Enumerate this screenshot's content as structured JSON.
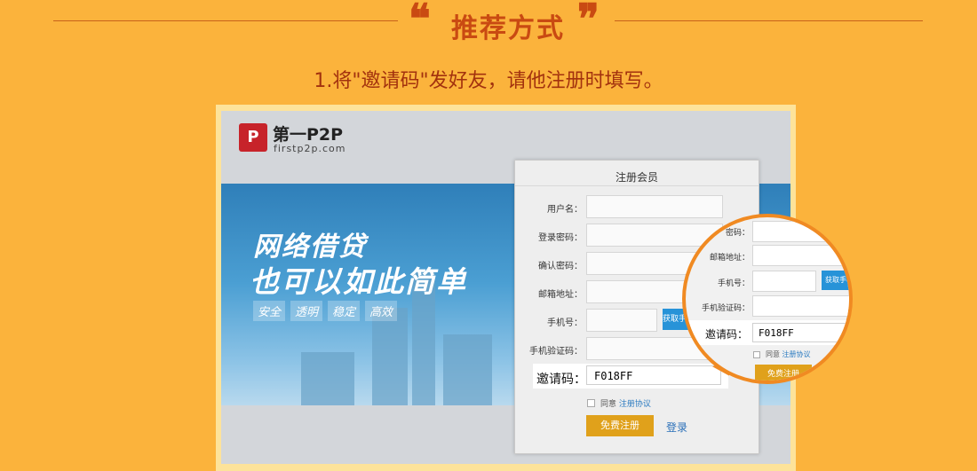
{
  "header": {
    "open_quote": "❝",
    "close_quote": "❞",
    "title": "推荐方式"
  },
  "step_text": "1.将\"邀请码\"发好友，请他注册时填写。",
  "site": {
    "logo_mark": "P",
    "logo_name": "第一P2P",
    "logo_url": "firstp2p.com",
    "slogan_line1": "网络借贷",
    "slogan_line2": "也可以如此简单",
    "tags": [
      "安全",
      "透明",
      "稳定",
      "高效"
    ]
  },
  "form": {
    "title": "注册会员",
    "username_label": "用户名：",
    "password_label": "登录密码：",
    "confirm_label": "确认密码：",
    "email_label": "邮箱地址：",
    "phone_label": "手机号：",
    "get_code_label": "获取手机",
    "verify_label": "手机验证码：",
    "invite_label": "邀请码：",
    "invite_value": "F018FF",
    "agree_text": "同意",
    "agreement_link": "注册协议",
    "register_button": "免费注册",
    "login_link": "登录"
  },
  "magnifier": {
    "password_partial": "密码：",
    "email_label": "邮箱地址：",
    "phone_label": "手机号：",
    "get_code_label": "获取手机",
    "verify_label": "手机验证码：",
    "invite_label": "邀请码：",
    "invite_value": "F018FF",
    "agree_text": "同意",
    "agreement_link": "注册协议",
    "register_button": "免费注册"
  },
  "colors": {
    "background": "#fbb33c",
    "title": "#c94a12",
    "accent": "#f08a22",
    "button": "#e0a11b",
    "link": "#2a7ac0"
  }
}
